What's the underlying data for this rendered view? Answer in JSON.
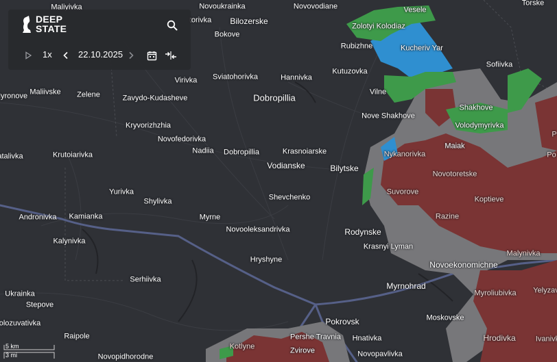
{
  "app": {
    "logo_line1": "DEEP",
    "logo_line2": "STATE",
    "speed": "1x",
    "date": "22.10.2025"
  },
  "colors": {
    "background": "#2f3136",
    "occupied": "#7a3434",
    "contested": "#77777a",
    "liberated": "#2f8fd0",
    "ukraine_control": "#3e9a4a",
    "road": "#565f86"
  },
  "icons": {
    "search": "search-icon",
    "play": "play-icon",
    "prev": "chevron-left-icon",
    "next": "chevron-right-icon",
    "calendar": "calendar-icon",
    "compare": "compare-arrows-icon"
  },
  "labels": {
    "malyivka": "Maliyivka",
    "novoukrainka": "Novoukrainka",
    "novovodiane": "Novovodiane",
    "torske": "Torske",
    "vesele": "Vesele",
    "bilozerske": "Bilozerske",
    "torivka": "torivka",
    "bokove": "Bokove",
    "zolotyi_kolodiaz": "Zolotyi Kolodiaz",
    "kucheriv_yar": "Kucheriv Yar",
    "rubizhne": "Rubizhne",
    "sofiivka": "Sofiivka",
    "kutuzovka": "Kutuzovka",
    "hannivka": "Hannivka",
    "sviatohorivka": "Sviatohorivka",
    "virivka": "Virivka",
    "maliivske": "Maliivske",
    "myronove": "Myronove",
    "zelene": "Zelene",
    "zavydo": "Zavydo-Kudasheve",
    "dobropillia": "Dobropillia",
    "vilne": "Vilne",
    "nove_shakhove": "Nove Shakhove",
    "shakhove": "Shakhove",
    "volodymyrivka": "Volodymyrivka",
    "kryvorizhzhia": "Kryvorizhzhia",
    "novofedorivka": "Novofedorivka",
    "nadiia": "Nadiia",
    "dobropillia_small": "Dobropillia",
    "krasnoiarske": "Krasnoiarske",
    "maiak": "Maiak",
    "atalivka": "atalivka",
    "krutoiarivka": "Krutoiarivka",
    "vodianske": "Vodianske",
    "bilytske": "Bilytske",
    "nykanorivka": "Nykanorivka",
    "novotoretske": "Novotoretske",
    "yurivka": "Yurivka",
    "shylivka": "Shylivka",
    "shevchenko": "Shevchenko",
    "suvorove": "Suvorove",
    "koptieve": "Koptieve",
    "andronivka": "Andronivka",
    "kamianka": "Kamianka",
    "myrne": "Myrne",
    "razine": "Razine",
    "novooleksandrivka": "Novooleksandrivka",
    "rodynske": "Rodynske",
    "kalynivka": "Kalynivka",
    "krasnyi_lyman": "Krasnyi Lyman",
    "malynivka": "Malynivka",
    "hryshyne": "Hryshyne",
    "novoekonomichne": "Novoekonomichne",
    "serhiivka": "Serhiivka",
    "myrnohrad": "Myrnohrad",
    "ukrainka": "Ukrainka",
    "myroliubivka": "Myroliubivka",
    "yelyzav": "Yelyzav",
    "stepove": "Stepove",
    "pokrovsk": "Pokrovsk",
    "moskovske": "Moskovske",
    "olozuvativka": "olozuvativka",
    "raipole": "Raipole",
    "pershe_travnia": "Pershe Travnia",
    "hnativka": "Hnativka",
    "hrodivka": "Hrodivka",
    "ivanivka": "Ivanivk",
    "kotlyne": "Kotlyne",
    "zvirove": "Zvirove",
    "novopidhorodne": "Novopidhorodne",
    "novopavlivka": "Novopavlivka",
    "p_edge": "P",
    "po_edge": "Po"
  },
  "scale": {
    "metric": "5 km",
    "imperial": "3 mi"
  }
}
